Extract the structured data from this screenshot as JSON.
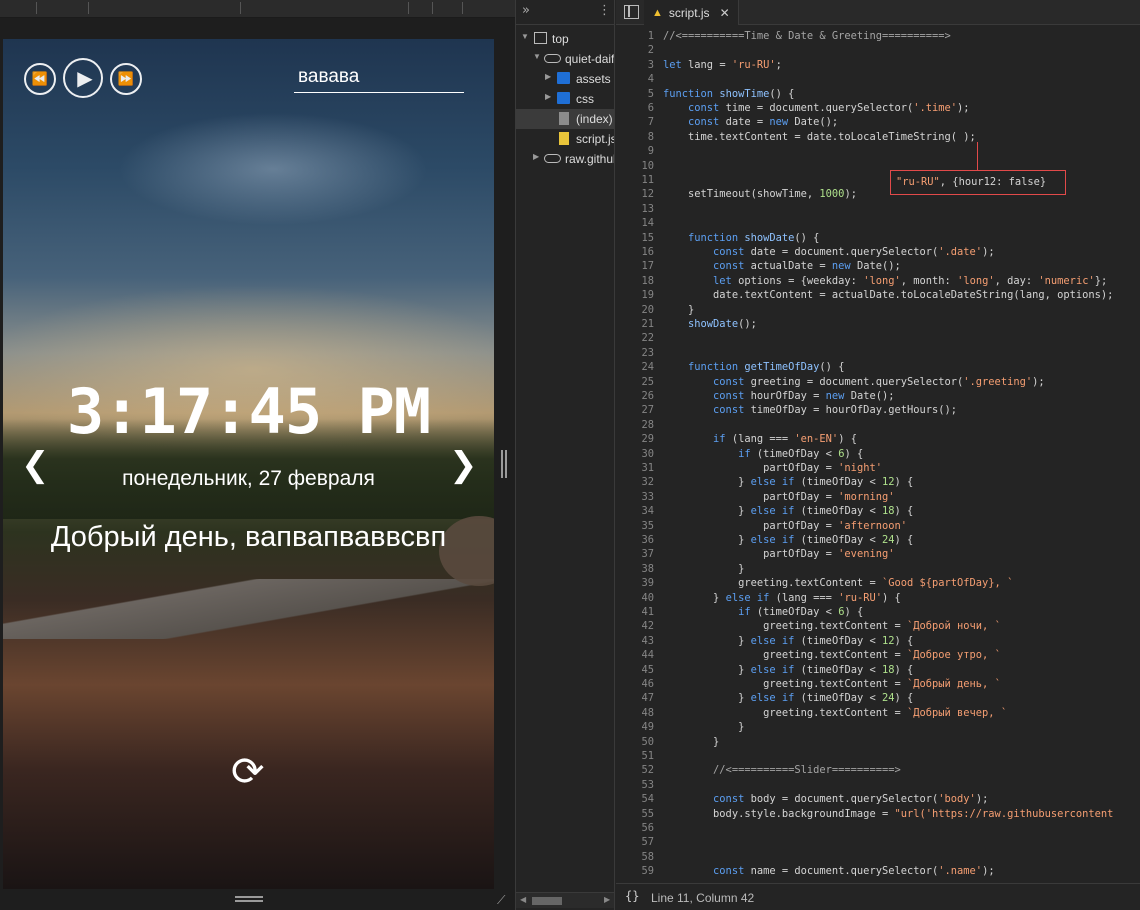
{
  "preview": {
    "name_value": "вавава",
    "time": "3:17:45 PM",
    "date": "понедельник, 27 февраля",
    "greeting": "Добрый день, вапвапваввсвп",
    "icons": {
      "prev": "⏪",
      "play": "▶",
      "next": "⏩",
      "slide_prev": "❮",
      "slide_next": "❯",
      "refresh": "⟳"
    }
  },
  "tree": {
    "items": [
      {
        "label": "top"
      },
      {
        "label": "quiet-daifuku"
      },
      {
        "label": "assets"
      },
      {
        "label": "css"
      },
      {
        "label": "(index)"
      },
      {
        "label": "script.js"
      },
      {
        "label": "raw.githubusercontent.com"
      }
    ]
  },
  "editor": {
    "tab_label": "script.js",
    "status": "Line 11, Column 42",
    "autocomplete_text": "\"ru-RU\", {hour12: false}",
    "lines": [
      {
        "n": 1,
        "t": "//<==========Time & Date & Greeting==========>"
      },
      {
        "n": 2,
        "t": ""
      },
      {
        "n": 3,
        "t": "let lang = 'ru-RU';"
      },
      {
        "n": 4,
        "t": ""
      },
      {
        "n": 5,
        "t": "function showTime() {"
      },
      {
        "n": 6,
        "t": "    const time = document.querySelector('.time');"
      },
      {
        "n": 7,
        "t": "    const date = new Date();"
      },
      {
        "n": 8,
        "t": "    time.textContent = date.toLocaleTimeString( );"
      },
      {
        "n": 9,
        "t": ""
      },
      {
        "n": 10,
        "t": ""
      },
      {
        "n": 11,
        "t": ""
      },
      {
        "n": 12,
        "t": "    setTimeout(showTime, 1000);"
      },
      {
        "n": 13,
        "t": ""
      },
      {
        "n": 14,
        "t": ""
      },
      {
        "n": 15,
        "t": "    function showDate() {"
      },
      {
        "n": 16,
        "t": "        const date = document.querySelector('.date');"
      },
      {
        "n": 17,
        "t": "        const actualDate = new Date();"
      },
      {
        "n": 18,
        "t": "        let options = {weekday: 'long', month: 'long', day: 'numeric'};"
      },
      {
        "n": 19,
        "t": "        date.textContent = actualDate.toLocaleDateString(lang, options);"
      },
      {
        "n": 20,
        "t": "    }"
      },
      {
        "n": 21,
        "t": "    showDate();"
      },
      {
        "n": 22,
        "t": ""
      },
      {
        "n": 23,
        "t": ""
      },
      {
        "n": 24,
        "t": "    function getTimeOfDay() {"
      },
      {
        "n": 25,
        "t": "        const greeting = document.querySelector('.greeting');"
      },
      {
        "n": 26,
        "t": "        const hourOfDay = new Date();"
      },
      {
        "n": 27,
        "t": "        const timeOfDay = hourOfDay.getHours();"
      },
      {
        "n": 28,
        "t": ""
      },
      {
        "n": 29,
        "t": "        if (lang === 'en-EN') {"
      },
      {
        "n": 30,
        "t": "            if (timeOfDay < 6) {"
      },
      {
        "n": 31,
        "t": "                partOfDay = 'night'"
      },
      {
        "n": 32,
        "t": "            } else if (timeOfDay < 12) {"
      },
      {
        "n": 33,
        "t": "                partOfDay = 'morning'"
      },
      {
        "n": 34,
        "t": "            } else if (timeOfDay < 18) {"
      },
      {
        "n": 35,
        "t": "                partOfDay = 'afternoon'"
      },
      {
        "n": 36,
        "t": "            } else if (timeOfDay < 24) {"
      },
      {
        "n": 37,
        "t": "                partOfDay = 'evening'"
      },
      {
        "n": 38,
        "t": "            }"
      },
      {
        "n": 39,
        "t": "            greeting.textContent = `Good ${partOfDay}, `"
      },
      {
        "n": 40,
        "t": "        } else if (lang === 'ru-RU') {"
      },
      {
        "n": 41,
        "t": "            if (timeOfDay < 6) {"
      },
      {
        "n": 42,
        "t": "                greeting.textContent = `Доброй ночи, `"
      },
      {
        "n": 43,
        "t": "            } else if (timeOfDay < 12) {"
      },
      {
        "n": 44,
        "t": "                greeting.textContent = `Доброе утро, `"
      },
      {
        "n": 45,
        "t": "            } else if (timeOfDay < 18) {"
      },
      {
        "n": 46,
        "t": "                greeting.textContent = `Добрый день, `"
      },
      {
        "n": 47,
        "t": "            } else if (timeOfDay < 24) {"
      },
      {
        "n": 48,
        "t": "                greeting.textContent = `Добрый вечер, `"
      },
      {
        "n": 49,
        "t": "            }"
      },
      {
        "n": 50,
        "t": "        }"
      },
      {
        "n": 51,
        "t": ""
      },
      {
        "n": 52,
        "t": "        //<==========Slider==========>"
      },
      {
        "n": 53,
        "t": ""
      },
      {
        "n": 54,
        "t": "        const body = document.querySelector('body');"
      },
      {
        "n": 55,
        "t": "        body.style.backgroundImage = \"url('https://raw.githubusercontent"
      },
      {
        "n": 56,
        "t": ""
      },
      {
        "n": 57,
        "t": ""
      },
      {
        "n": 58,
        "t": ""
      },
      {
        "n": 59,
        "t": "        const name = document.querySelector('.name');"
      }
    ]
  },
  "colors": {
    "keyword": "#5c9ff2",
    "string": "#f59e72",
    "highlight_box": "#e24a4a",
    "folder": "#1f6fd6",
    "js_file": "#e8c43a"
  }
}
